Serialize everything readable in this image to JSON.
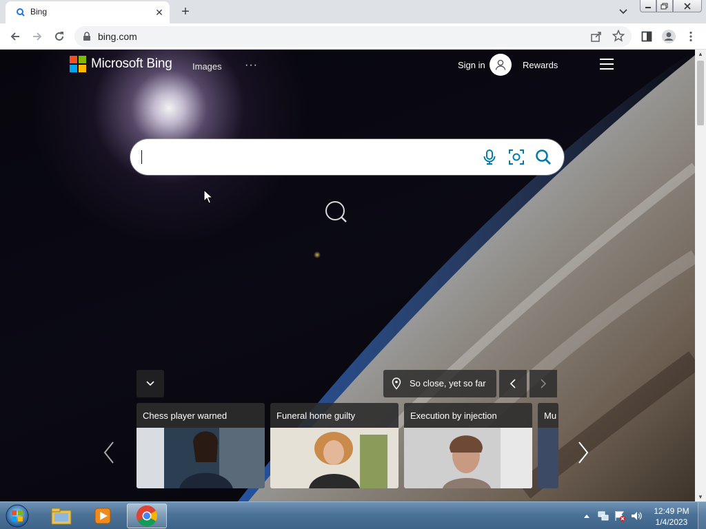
{
  "browser": {
    "tab": {
      "title": "Bing",
      "favicon": "bing-search-icon"
    },
    "address": {
      "url": "bing.com"
    },
    "icons": [
      "back-icon",
      "forward-icon",
      "reload-icon",
      "lock-icon",
      "share-icon",
      "star-icon",
      "side-panel-icon",
      "profile-icon",
      "menu-dots-icon"
    ]
  },
  "bing": {
    "logo_text": "Microsoft Bing",
    "nav": {
      "images": "Images",
      "more": "···"
    },
    "sign_in": "Sign in",
    "rewards": "Rewards",
    "search": {
      "value": "",
      "placeholder": ""
    },
    "location_label": "So close, yet so far",
    "news_cards": [
      {
        "title": "Chess player warned"
      },
      {
        "title": "Funeral home guilty"
      },
      {
        "title": "Execution by injection"
      },
      {
        "title": "Mu"
      }
    ],
    "colors": {
      "ms_red": "#f25022",
      "ms_green": "#7fba00",
      "ms_blue": "#00a4ef",
      "ms_yellow": "#ffb900",
      "search_icon": "#007daa"
    }
  },
  "taskbar": {
    "apps": [
      "explorer-icon",
      "media-player-icon",
      "chrome-icon"
    ],
    "clock": {
      "time": "12:49 PM",
      "date": "1/4/2023"
    }
  }
}
